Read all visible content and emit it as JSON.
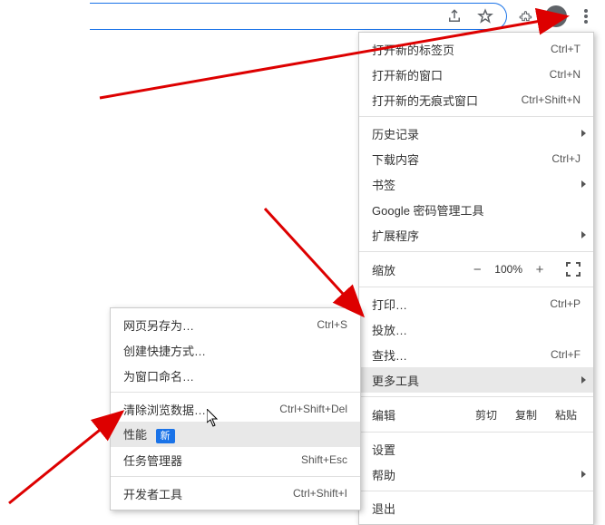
{
  "toolbar": {
    "share": "share",
    "star": "star",
    "ext": "extensions",
    "profile": "profile",
    "menu": "menu"
  },
  "menu": {
    "newTab": {
      "label": "打开新的标签页",
      "shortcut": "Ctrl+T"
    },
    "newWindow": {
      "label": "打开新的窗口",
      "shortcut": "Ctrl+N"
    },
    "incognito": {
      "label": "打开新的无痕式窗口",
      "shortcut": "Ctrl+Shift+N"
    },
    "history": {
      "label": "历史记录"
    },
    "downloads": {
      "label": "下载内容",
      "shortcut": "Ctrl+J"
    },
    "bookmarks": {
      "label": "书签"
    },
    "passwords": {
      "label": "Google 密码管理工具"
    },
    "extensions": {
      "label": "扩展程序"
    },
    "zoom": {
      "label": "缩放",
      "pct": "100%"
    },
    "print": {
      "label": "打印…",
      "shortcut": "Ctrl+P"
    },
    "cast": {
      "label": "投放…"
    },
    "find": {
      "label": "查找…",
      "shortcut": "Ctrl+F"
    },
    "moreTools": {
      "label": "更多工具"
    },
    "edit": {
      "label": "编辑",
      "cut": "剪切",
      "copy": "复制",
      "paste": "粘贴"
    },
    "settings": {
      "label": "设置"
    },
    "help": {
      "label": "帮助"
    },
    "exit": {
      "label": "退出"
    }
  },
  "submenu": {
    "saveAs": {
      "label": "网页另存为…",
      "shortcut": "Ctrl+S"
    },
    "shortcut": {
      "label": "创建快捷方式…"
    },
    "nameWindow": {
      "label": "为窗口命名…"
    },
    "clearData": {
      "label": "清除浏览数据…",
      "shortcut": "Ctrl+Shift+Del"
    },
    "performance": {
      "label": "性能",
      "badge": "新"
    },
    "taskManager": {
      "label": "任务管理器",
      "shortcut": "Shift+Esc"
    },
    "devTools": {
      "label": "开发者工具",
      "shortcut": "Ctrl+Shift+I"
    }
  }
}
